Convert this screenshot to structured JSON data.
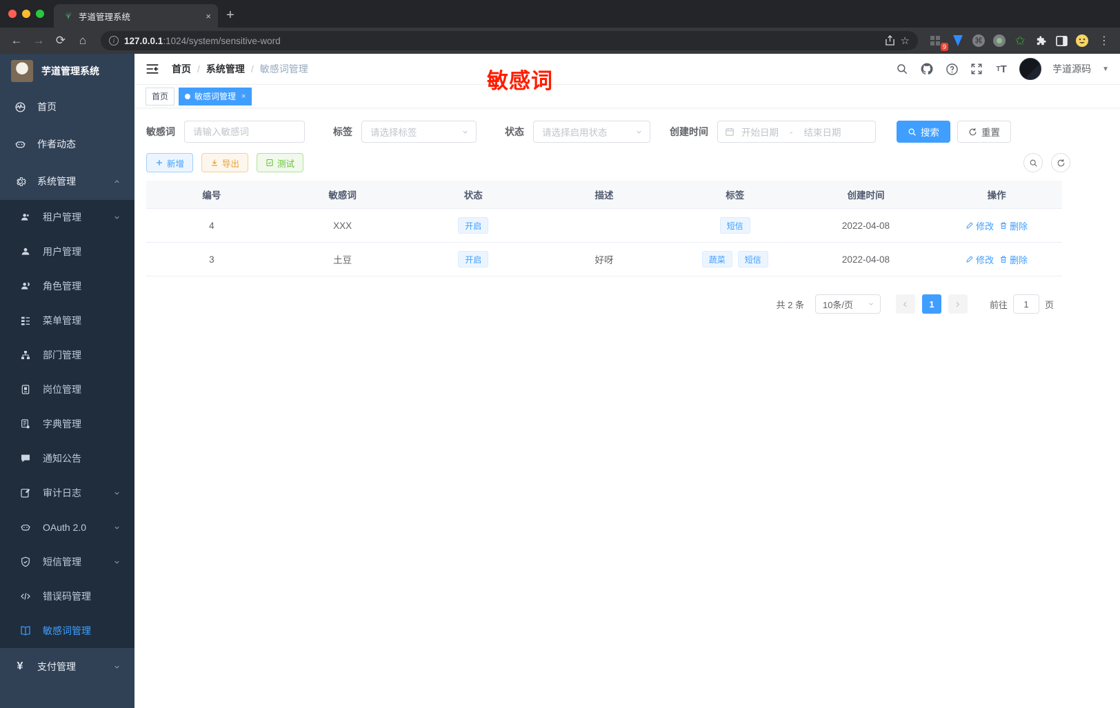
{
  "browser": {
    "tab_title": "芋道管理系统",
    "close_tab": "×",
    "new_tab": "+",
    "url_host": "127.0.0.1",
    "url_rest": ":1024/system/sensitive-word",
    "ext_badge": "9",
    "back": "←",
    "forward": "→",
    "reload": "⟳",
    "home": "⌂",
    "star": "☆",
    "kebab": "⋮",
    "cmd": "⌘",
    "green_star": "✩"
  },
  "annotation": {
    "text": "敏感词"
  },
  "sidebar": {
    "title": "芋道管理系统",
    "items": [
      {
        "label": "首页",
        "icon": "dashboard-icon"
      },
      {
        "label": "作者动态",
        "icon": "robot-icon"
      },
      {
        "label": "系统管理",
        "icon": "gear-icon"
      }
    ],
    "submenu": [
      {
        "label": "租户管理",
        "icon": "tenant-icon"
      },
      {
        "label": "用户管理",
        "icon": "user-icon"
      },
      {
        "label": "角色管理",
        "icon": "role-icon"
      },
      {
        "label": "菜单管理",
        "icon": "menu-tree-icon"
      },
      {
        "label": "部门管理",
        "icon": "org-icon"
      },
      {
        "label": "岗位管理",
        "icon": "post-icon"
      },
      {
        "label": "字典管理",
        "icon": "dict-icon"
      },
      {
        "label": "通知公告",
        "icon": "notice-icon"
      },
      {
        "label": "审计日志",
        "icon": "audit-icon"
      },
      {
        "label": "OAuth 2.0",
        "icon": "oauth-icon"
      },
      {
        "label": "短信管理",
        "icon": "sms-shield-icon"
      },
      {
        "label": "错误码管理",
        "icon": "code-icon"
      },
      {
        "label": "敏感词管理",
        "icon": "book-icon"
      }
    ],
    "footer_item": {
      "label": "支付管理",
      "icon": "yen-icon",
      "yen": "¥"
    }
  },
  "header": {
    "breadcrumb": [
      "首页",
      "系统管理",
      "敏感词管理"
    ],
    "separator": "/",
    "username": "芋道源码"
  },
  "tags": {
    "home": "首页",
    "current": "敏感词管理",
    "close": "×"
  },
  "filters": {
    "word_label": "敏感词",
    "word_placeholder": "请输入敏感词",
    "tag_label": "标签",
    "tag_placeholder": "请选择标签",
    "status_label": "状态",
    "status_placeholder": "请选择启用状态",
    "time_label": "创建时间",
    "start_placeholder": "开始日期",
    "range_sep": "-",
    "end_placeholder": "结束日期",
    "search_label": "搜索",
    "reset_label": "重置"
  },
  "toolbar": {
    "add_label": "新增",
    "export_label": "导出",
    "test_label": "测试"
  },
  "table": {
    "headers": [
      "编号",
      "敏感词",
      "状态",
      "描述",
      "标签",
      "创建时间",
      "操作"
    ],
    "rows": [
      {
        "id": "4",
        "word": "XXX",
        "status": "开启",
        "desc": "",
        "tags": [
          "短信"
        ],
        "created": "2022-04-08"
      },
      {
        "id": "3",
        "word": "土豆",
        "status": "开启",
        "desc": "好呀",
        "tags": [
          "蔬菜",
          "短信"
        ],
        "created": "2022-04-08"
      }
    ],
    "edit_label": "修改",
    "delete_label": "删除"
  },
  "pagination": {
    "total": "共 2 条",
    "page_size": "10条/页",
    "page": "1",
    "goto_prefix": "前往",
    "goto_value": "1",
    "goto_suffix": "页"
  },
  "colors": {
    "primary": "#409eff",
    "sidebar_bg": "#304156",
    "submenu_bg": "#1f2d3d",
    "warning": "#e6a23c",
    "success": "#67c23a",
    "annotation_red": "#ff1d00"
  }
}
